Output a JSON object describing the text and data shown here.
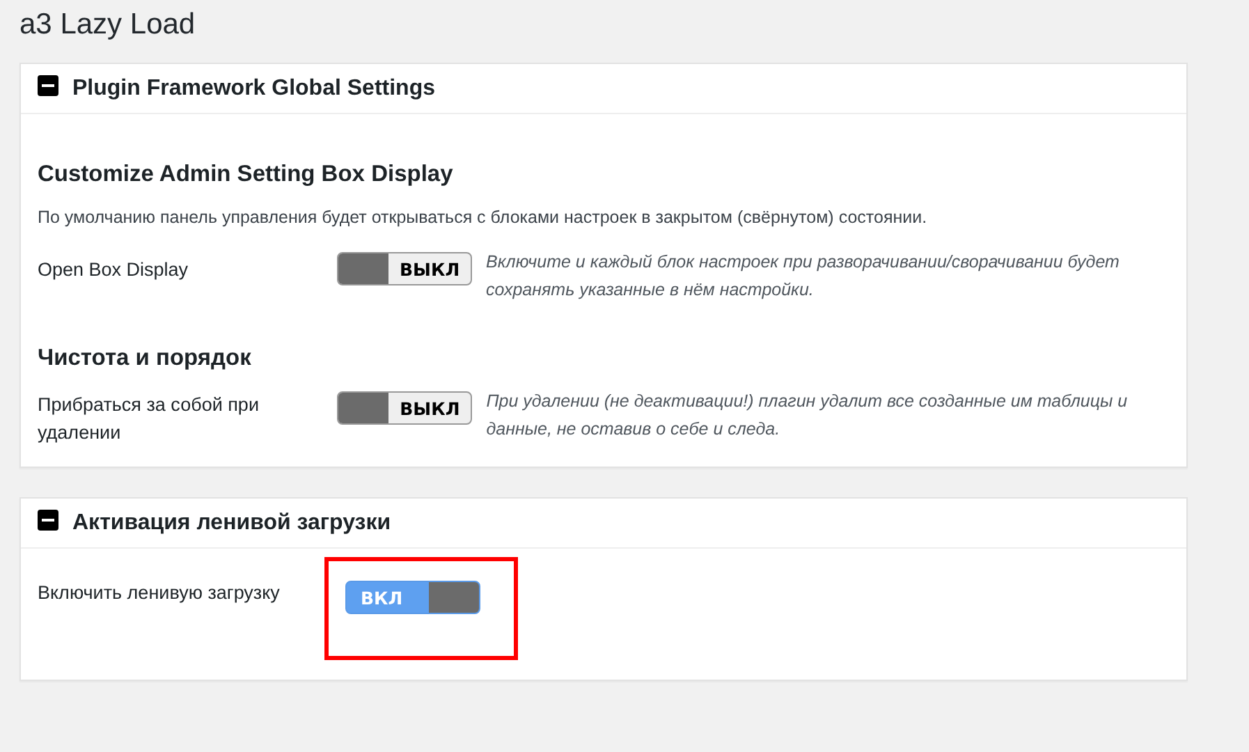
{
  "page_title": "a3 Lazy Load",
  "panels": [
    {
      "title": "Plugin Framework Global Settings",
      "expanded": true,
      "sections": [
        {
          "heading": "Customize Admin Setting Box Display",
          "description": "По умолчанию панель управления будет открываться с блоками настроек в закрытом (свёрнутом) состоянии.",
          "settings": [
            {
              "label": "Open Box Display",
              "on": false,
              "toggle_label": "ВЫКЛ",
              "help": "Включите и каждый блок настроек при разворачивании/сворачивании будет сохранять указанные в нём настройки.",
              "highlighted": false
            }
          ]
        },
        {
          "heading": "Чистота и порядок",
          "settings": [
            {
              "label": "Прибраться за собой при удалении",
              "on": false,
              "toggle_label": "ВЫКЛ",
              "help": "При удалении (не деактивации!) плагин удалит все созданные им таблицы и данные, не оставив о себе и следа.",
              "highlighted": false
            }
          ]
        }
      ]
    },
    {
      "title": "Активация ленивой загрузки",
      "expanded": true,
      "sections": [
        {
          "settings": [
            {
              "label": "Включить ленивую загрузку",
              "on": true,
              "toggle_label": "ВКЛ",
              "highlighted": true
            }
          ]
        }
      ]
    }
  ]
}
